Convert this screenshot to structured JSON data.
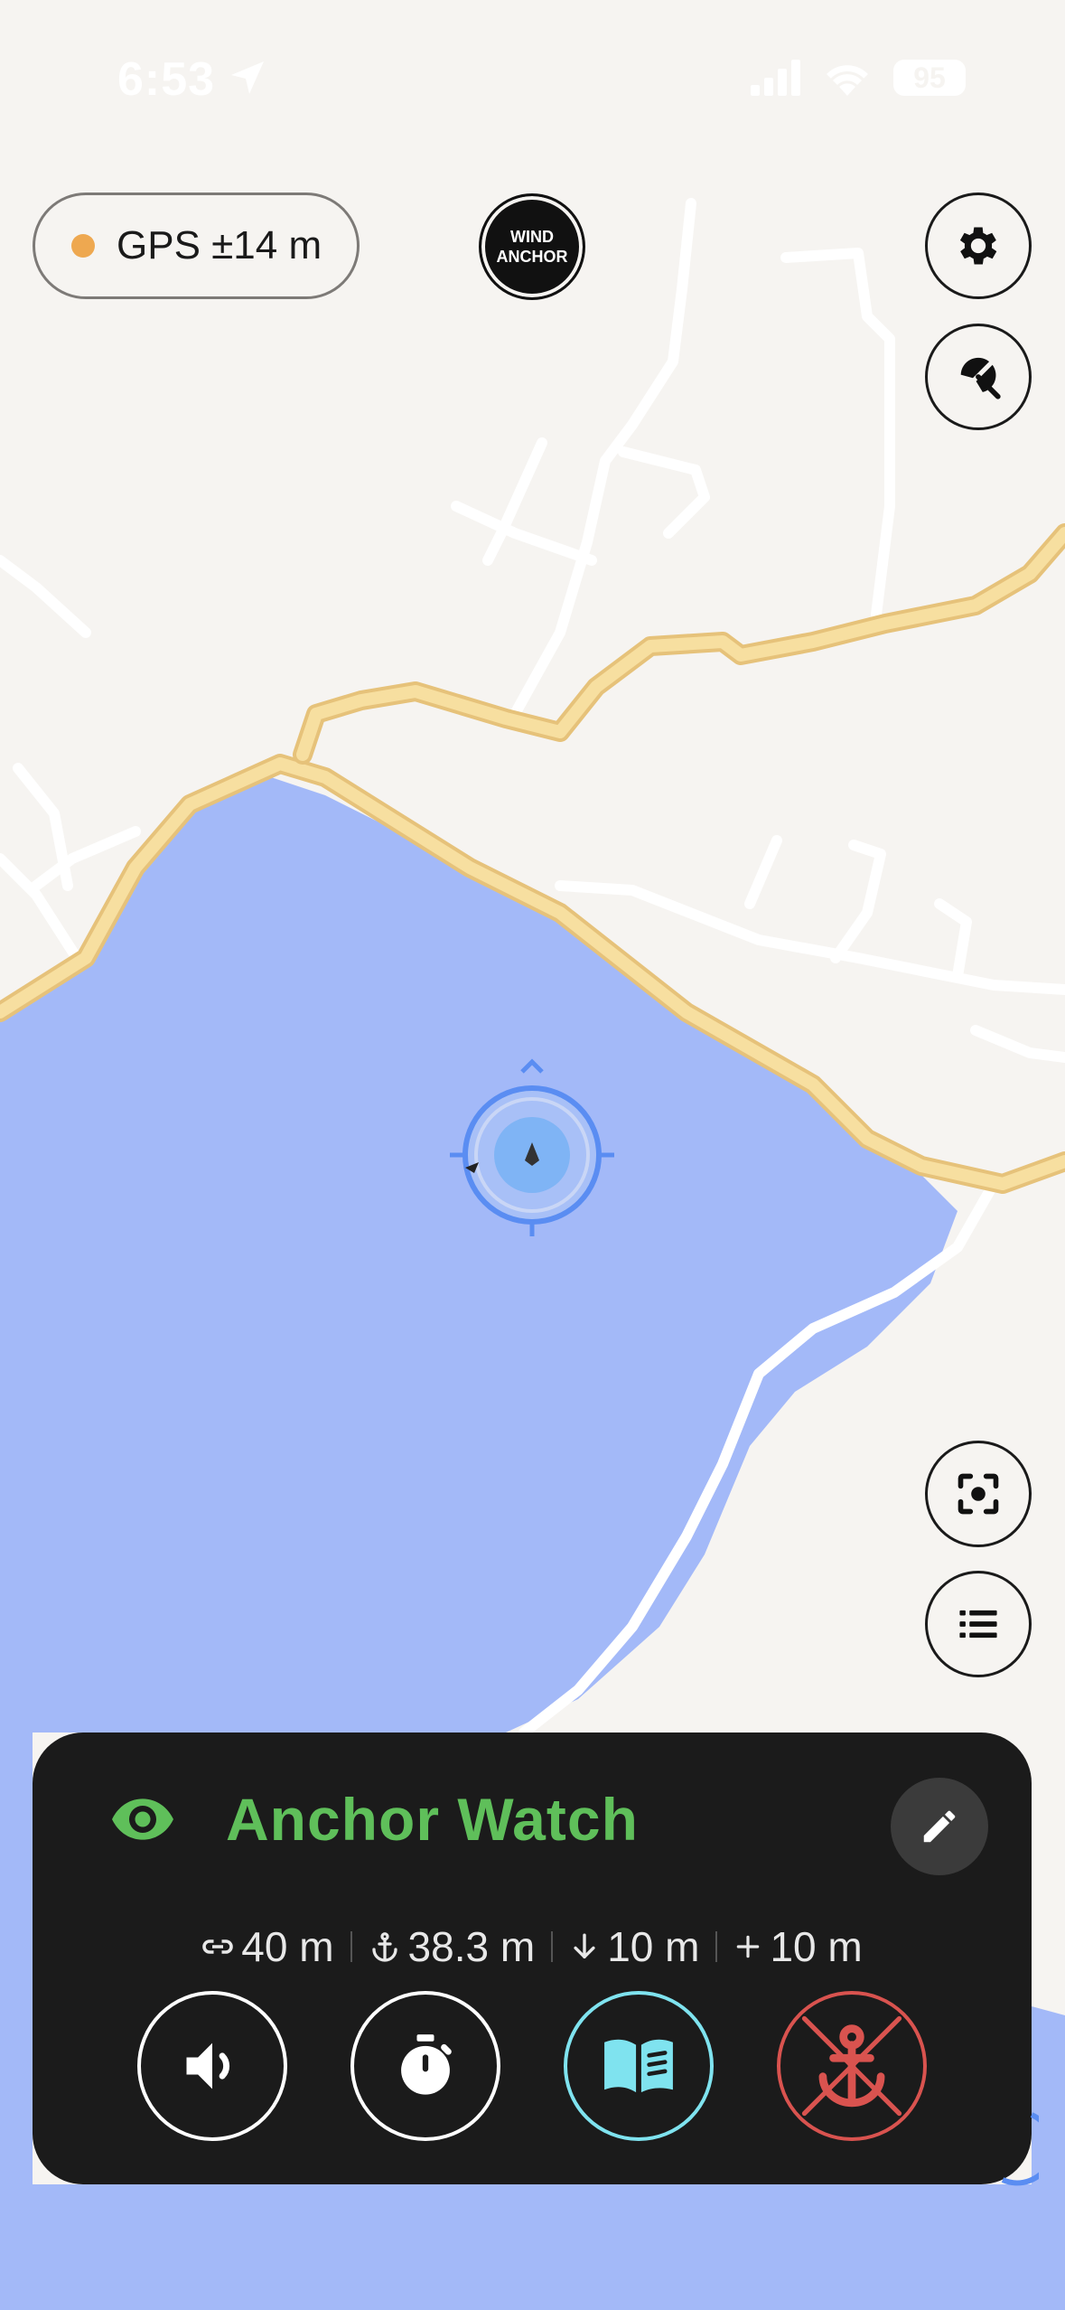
{
  "status_bar": {
    "time": "6:53",
    "battery": "95",
    "icons": [
      "location-arrow-icon",
      "signal-icon",
      "wifi-icon",
      "battery-icon"
    ]
  },
  "gps": {
    "label": "GPS ±14 m",
    "dot_color": "#eea850"
  },
  "logo": {
    "line1": "WIND",
    "line2": "ANCHOR"
  },
  "map_buttons": [
    "gear-icon",
    "beach-umbrella-icon",
    "recenter-icon",
    "list-icon"
  ],
  "panel": {
    "title": "Anchor Watch",
    "title_color": "#5fbf5a",
    "stats": {
      "rode": "40 m",
      "anchor_distance": "38.3 m",
      "depth": "10 m",
      "extra": "10 m"
    },
    "actions": [
      "speaker-icon",
      "stopwatch-icon",
      "book-icon",
      "anchor-off-icon"
    ],
    "colors": {
      "book": "#7fe3ef",
      "anchor_off": "#d9534f",
      "background": "#1b1b1b"
    }
  },
  "colors": {
    "water": "#a3b9f8",
    "land": "#f6f4f1",
    "road_major": "#f7dfa0",
    "accent_blue": "#5a8df2"
  }
}
